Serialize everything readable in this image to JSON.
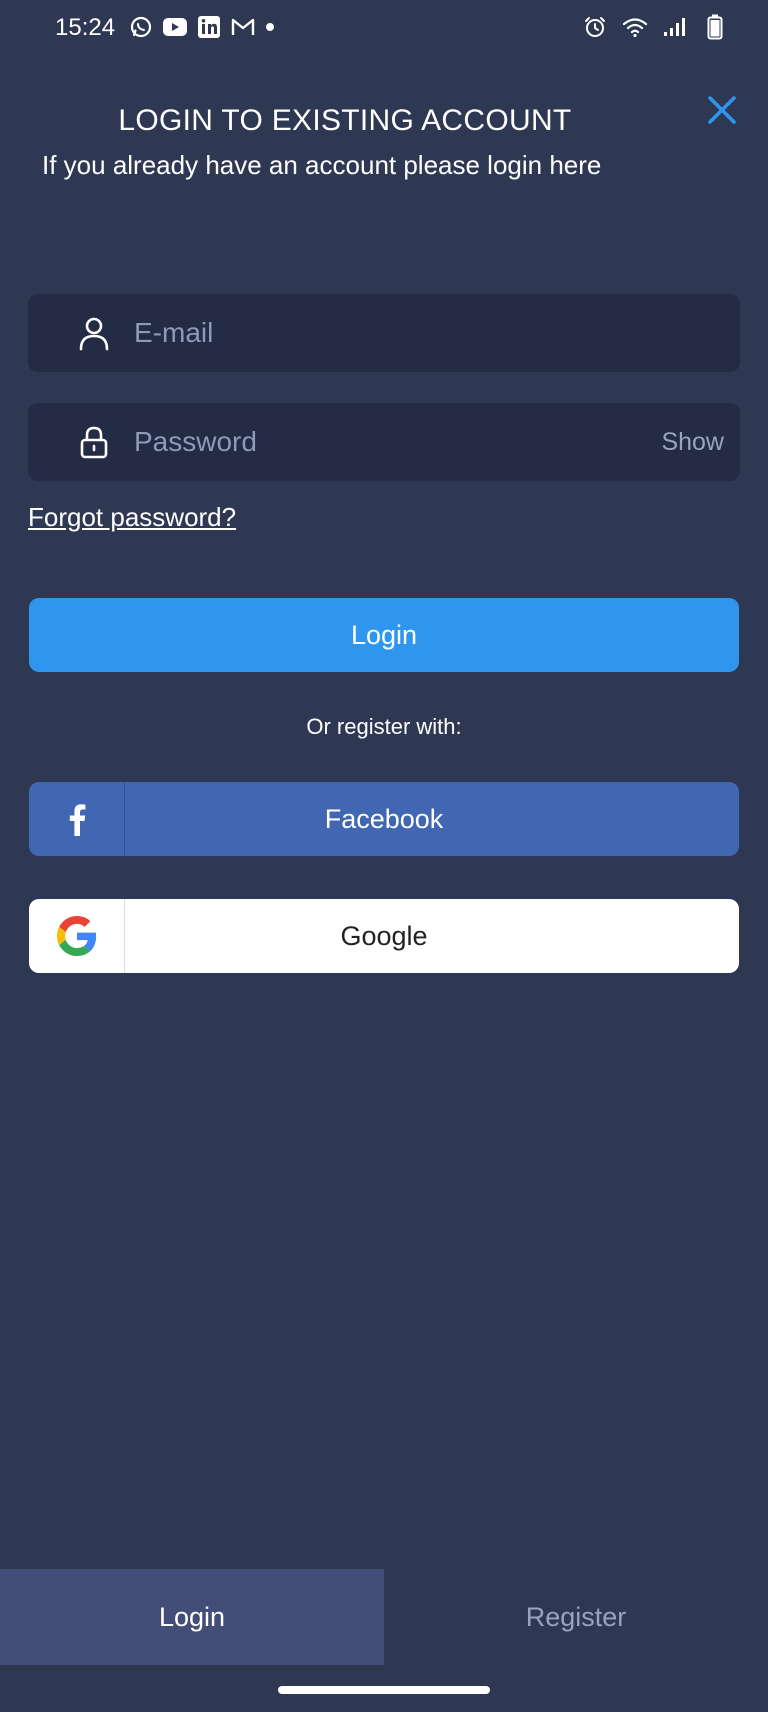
{
  "status_bar": {
    "time": "15:24",
    "left_icons": [
      "whatsapp-icon",
      "youtube-icon",
      "linkedin-icon",
      "gmail-icon",
      "dot-icon"
    ],
    "right_icons": [
      "alarm-icon",
      "wifi-icon",
      "signal-icon",
      "battery-icon"
    ]
  },
  "header": {
    "title": "LOGIN TO EXISTING ACCOUNT",
    "subtitle": "If you already have an account please login here"
  },
  "form": {
    "email": {
      "value": "",
      "placeholder": "E-mail"
    },
    "password": {
      "value": "",
      "placeholder": "Password",
      "show_label": "Show"
    },
    "forgot_label": "Forgot password?",
    "login_label": "Login"
  },
  "social": {
    "or_text": "Or register with:",
    "facebook_label": "Facebook",
    "google_label": "Google"
  },
  "tabs": {
    "login": "Login",
    "register": "Register",
    "active": "login"
  },
  "colors": {
    "background": "#2e3853",
    "input_bg": "#232b45",
    "primary": "#2f96ee",
    "facebook": "#4267b2",
    "active_tab": "#434e78",
    "close_icon": "#2f96ee"
  }
}
